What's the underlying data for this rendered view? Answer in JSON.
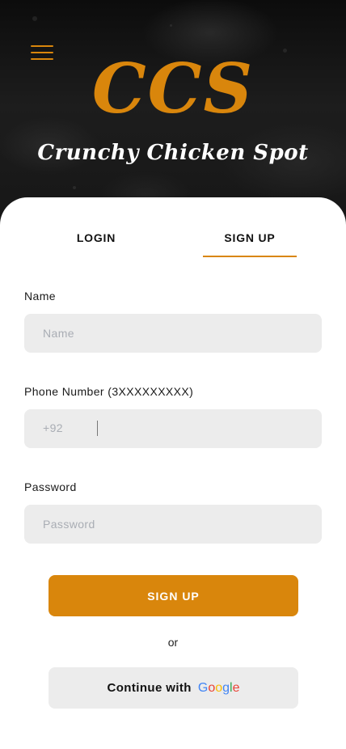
{
  "header": {
    "logo_text": "CCS",
    "tagline": "Crunchy Chicken Spot",
    "menu_icon": "hamburger-menu-icon"
  },
  "tabs": [
    {
      "label": "LOGIN",
      "active": false
    },
    {
      "label": "SIGN UP",
      "active": true
    }
  ],
  "form": {
    "name": {
      "label": "Name",
      "placeholder": "Name",
      "value": ""
    },
    "phone": {
      "label": "Phone Number (3XXXXXXXXX)",
      "prefix": "+92",
      "value": ""
    },
    "password": {
      "label": "Password",
      "placeholder": "Password",
      "value": ""
    }
  },
  "actions": {
    "signup_label": "SIGN UP",
    "or_text": "or",
    "google_label": "Continue with",
    "google_logo_text": [
      "G",
      "o",
      "o",
      "g",
      "l",
      "e"
    ]
  },
  "colors": {
    "accent": "#d9860c",
    "field_bg": "#ececec",
    "google_blue": "#4285f4",
    "google_red": "#ea4335",
    "google_yellow": "#fbbc05",
    "google_green": "#34a853"
  }
}
